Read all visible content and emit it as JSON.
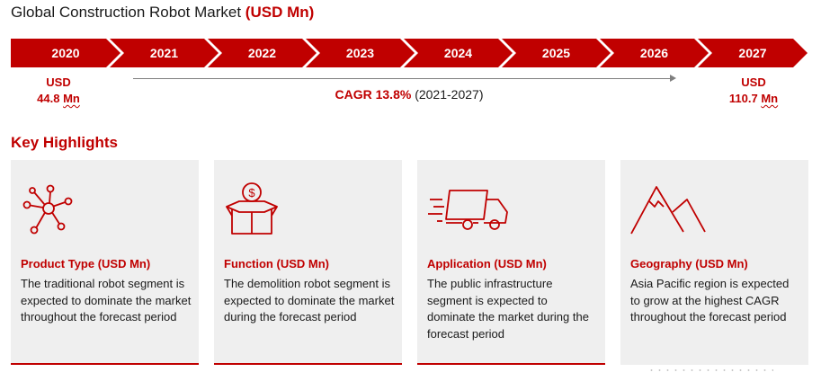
{
  "header": {
    "title_main": "Global Construction Robot Market ",
    "title_accent": "(USD Mn)"
  },
  "timeline": {
    "years": [
      "2020",
      "2021",
      "2022",
      "2023",
      "2024",
      "2025",
      "2026",
      "2027"
    ],
    "accent_color": "#c00000"
  },
  "start_value": {
    "prefix": "USD",
    "amount": "44.8",
    "unit": "Mn"
  },
  "end_value": {
    "prefix": "USD",
    "amount": "110.7",
    "unit": "Mn"
  },
  "cagr": {
    "value": "CAGR 13.8%",
    "range": " (2021-2027)"
  },
  "section_title": "Key Highlights",
  "cards": [
    {
      "icon": "network-nodes-icon",
      "title": "Product Type (USD Mn)",
      "text": "The traditional robot segment is expected to dominate the market throughout the forecast period"
    },
    {
      "icon": "money-box-icon",
      "title": "Function (USD Mn)",
      "text": "The demolition robot segment is expected to dominate the market during the forecast period"
    },
    {
      "icon": "delivery-truck-icon",
      "title": "Application (USD Mn)",
      "text": "The public infrastructure segment is expected to dominate the market during the forecast period"
    },
    {
      "icon": "mountains-icon",
      "title": "Geography (USD Mn)",
      "text": "Asia Pacific region is expected to grow at the highest CAGR throughout the forecast period"
    }
  ]
}
